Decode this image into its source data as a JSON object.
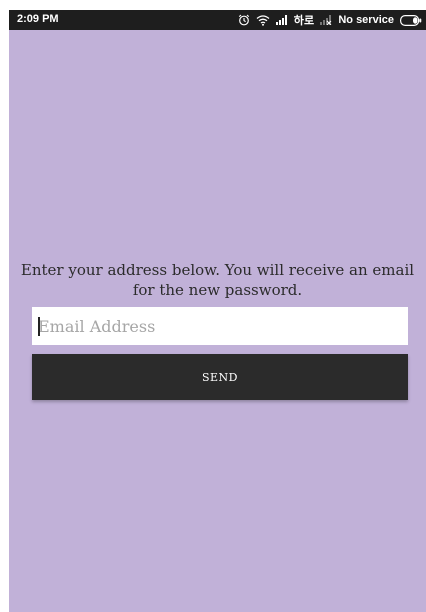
{
  "status_bar": {
    "time": "2:09 PM",
    "carrier": "하로",
    "service": "No service",
    "icons": [
      "alarm-icon",
      "wifi-icon",
      "signal-icon",
      "signal-weak-icon",
      "battery-icon"
    ]
  },
  "form": {
    "instruction": "Enter your address below. You will receive an email for the new password.",
    "email_placeholder": "Email Address",
    "email_value": "",
    "send_label": "SEND"
  },
  "colors": {
    "background": "#c1b1d8",
    "status_bar": "#1e1e1e",
    "button": "#2b2b2b",
    "input": "#ffffff"
  }
}
